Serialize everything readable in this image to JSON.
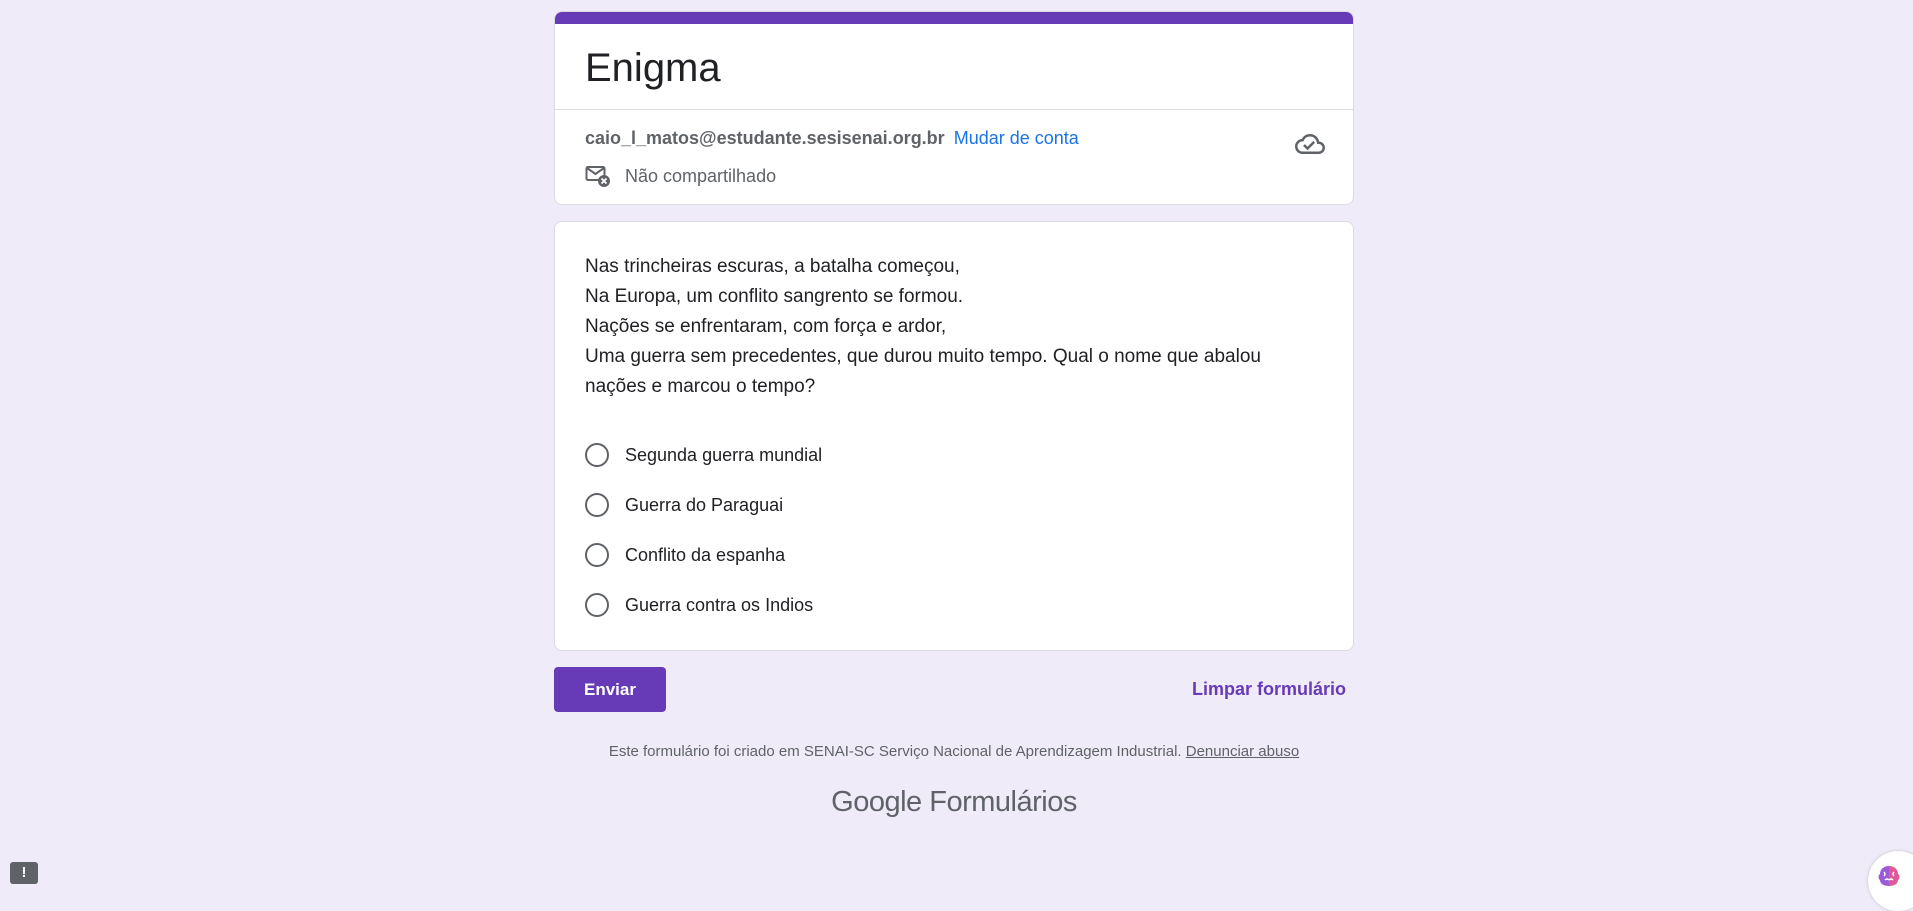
{
  "header": {
    "title": "Enigma",
    "account_email": "caio_l_matos@estudante.sesisenai.org.br",
    "switch_account": "Mudar de conta",
    "sharing_status": "Não compartilhado"
  },
  "question": {
    "text": "Nas trincheiras escuras, a batalha começou,\nNa Europa, um conflito sangrento se formou.\nNações se enfrentaram, com força e ardor,\nUma guerra sem precedentes, que durou muito tempo. Qual o nome que abalou nações e marcou o tempo?",
    "options": [
      {
        "label": "Segunda guerra mundial"
      },
      {
        "label": "Guerra do Paraguai"
      },
      {
        "label": "Conflito da espanha"
      },
      {
        "label": "Guerra contra os Indios"
      }
    ]
  },
  "actions": {
    "submit": "Enviar",
    "clear": "Limpar formulário"
  },
  "footer": {
    "text": "Este formulário foi criado em SENAI-SC Serviço Nacional de Aprendizagem Industrial.",
    "report": "Denunciar abuso",
    "brand_google": "Google",
    "brand_product": "Formulários"
  },
  "misc": {
    "report_icon_glyph": "!"
  },
  "colors": {
    "accent": "#673ab7",
    "background": "#f0ebf8",
    "link": "#1a73e8"
  },
  "icons": [
    "cloud-check-icon",
    "mail-not-shared-icon",
    "report-problem-icon",
    "assistant-icon"
  ]
}
